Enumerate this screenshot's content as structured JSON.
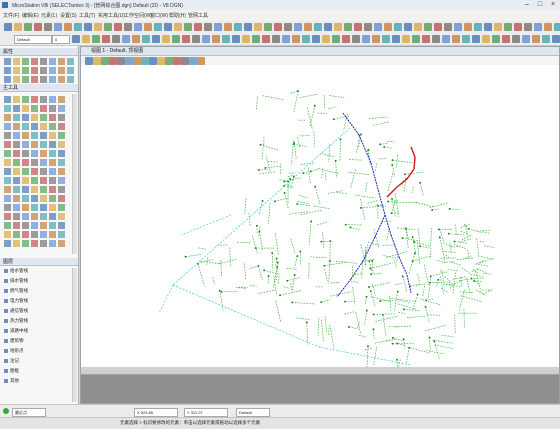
{
  "window": {
    "title": "MicroStation V8i (SELECTseries 3) - [管网综合图.dgn] Default (2D - V8 DGN)",
    "min_label": "–",
    "max_label": "□",
    "close_label": "×"
  },
  "menu": {
    "items": [
      "文件(F)",
      "编辑(E)",
      "元素(L)",
      "设置(S)",
      "工具(T)",
      "实用工具(U)",
      "工作空间(W)",
      "窗口(W)",
      "帮助(H)",
      "管网工具"
    ]
  },
  "toolbar": {
    "level_combo": "Default",
    "style_combo": "0"
  },
  "left_panel": {
    "attributes_label": "属性",
    "tools_label": "主工具",
    "tree_label": "图层",
    "tree_items": [
      "给水管线",
      "排水管线",
      "燃气管线",
      "电力管线",
      "通信管线",
      "热力管线",
      "道路中线",
      "建筑物",
      "地形点",
      "注记",
      "图框",
      "其他"
    ]
  },
  "document": {
    "title": "视图 1 - Default, 顶视图",
    "view_label": "1"
  },
  "status": {
    "snap_label": "最近点",
    "coord_x": "X 523.85",
    "coord_y": "Y 311.07",
    "level_status": "Default"
  },
  "bottom": {
    "prompt": "元素选择 > 标识要修改的元素：单击以选择元素或拖动以选择多个元素"
  },
  "colors": {
    "network_green": "#3fb53f",
    "network_blue": "#2020c8",
    "network_cyan": "#39c8d6",
    "network_red": "#d01818",
    "title_bg": "#e8edf4"
  }
}
